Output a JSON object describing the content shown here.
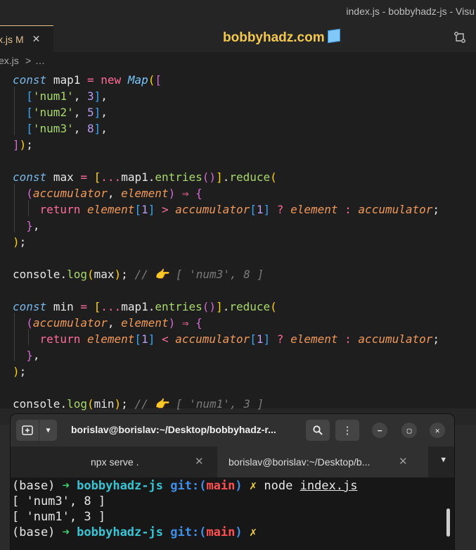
{
  "window": {
    "title": "index.js - bobbyhadz-js - Visu",
    "site_title": "bobbyhadz.com",
    "active_tab": {
      "name": "x.js",
      "status": "M",
      "close": "✕"
    },
    "breadcrumb": {
      "file": "ex.js",
      "sep": ">",
      "rest": "…"
    }
  },
  "code": {
    "l1": [
      "const",
      "map1",
      "=",
      "new",
      "Map",
      "(",
      "["
    ],
    "l2": [
      "['num1', ",
      "3",
      "],"
    ],
    "l3": [
      "['num2', ",
      "5",
      "],"
    ],
    "l4": [
      "['num3', ",
      "8",
      "],"
    ],
    "l5": "]);",
    "max_decl": {
      "name": "max",
      "spread": "...",
      "obj": "map1",
      "method": "entries",
      "reduce": "reduce"
    },
    "min_decl": {
      "name": "min",
      "spread": "...",
      "obj": "map1",
      "method": "entries",
      "reduce": "reduce"
    },
    "params": [
      "accumulator",
      "element"
    ],
    "ret_kw": "return",
    "cmp_max": ">",
    "cmp_min": "<",
    "log1": {
      "fn": "console",
      "method": "log",
      "arg": "max",
      "comment": "// 👉 [ 'num3', 8 ]"
    },
    "log2": {
      "fn": "console",
      "method": "log",
      "arg": "min",
      "comment": "// 👉 [ 'num1', 3 ]"
    }
  },
  "terminal": {
    "title": "borislav@borislav:~/Desktop/bobbyhadz-r...",
    "tabs": [
      {
        "label": "npx serve .",
        "close": "✕"
      },
      {
        "label": "borislav@borislav:~/Desktop/b...",
        "close": "✕"
      }
    ],
    "prompt": {
      "base": "(base)",
      "arrow": "➜",
      "dir": "bobbyhadz-js",
      "git": "git:(",
      "branch": "main",
      "git_end": ")",
      "dirty": "✗"
    },
    "command": {
      "cmd": "node",
      "file": "index.js"
    },
    "output": [
      "[ 'num3', 8 ]",
      "[ 'num1', 3 ]"
    ]
  }
}
